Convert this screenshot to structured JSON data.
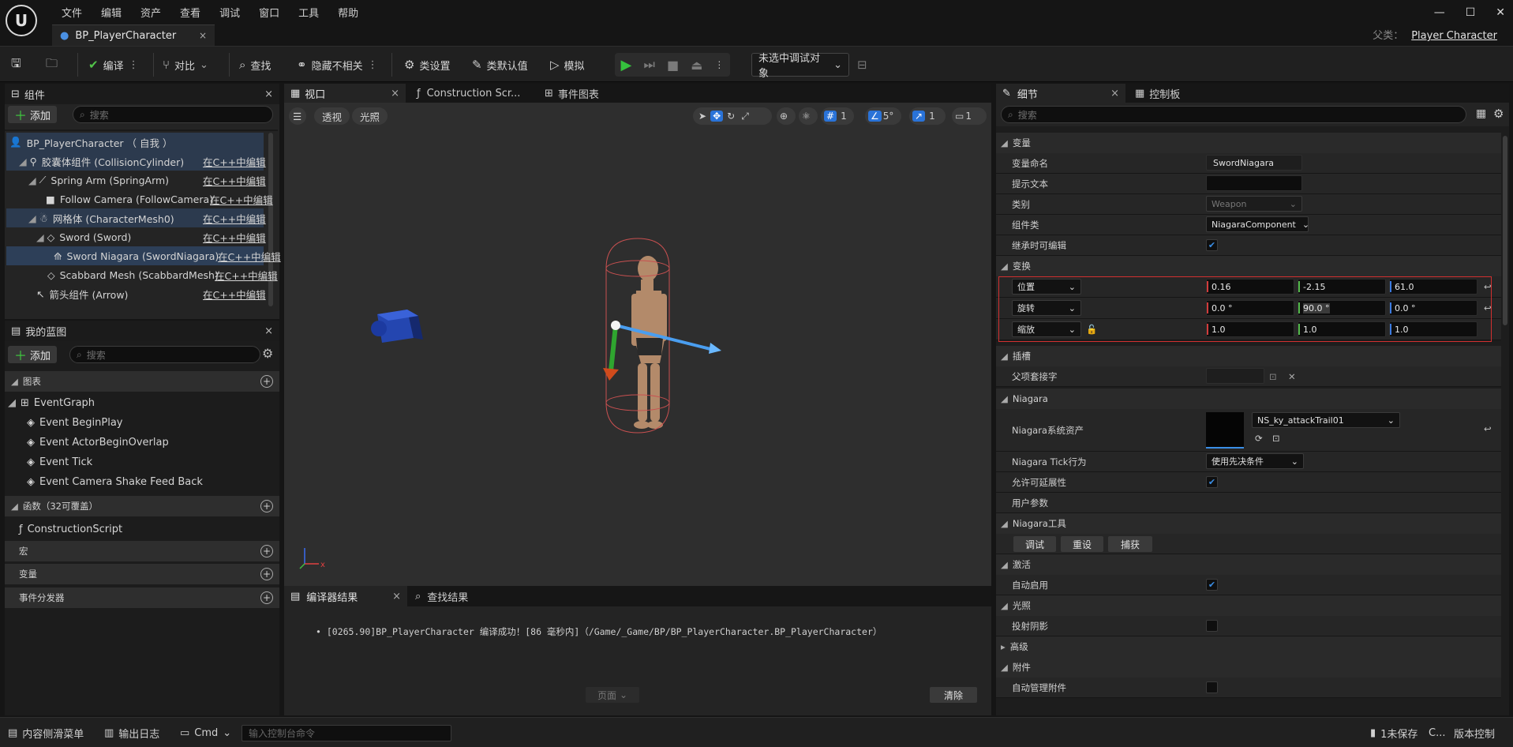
{
  "menu": [
    "文件",
    "编辑",
    "资产",
    "查看",
    "调试",
    "窗口",
    "工具",
    "帮助"
  ],
  "tab": {
    "title": "BP_PlayerCharacter",
    "close": "×"
  },
  "parent": {
    "label": "父类：",
    "value": "Player Character"
  },
  "window": {
    "min": "—",
    "max": "☐",
    "close": "✕"
  },
  "toolbar": {
    "compile": "编译",
    "diff": "对比",
    "find": "查找",
    "hide_unrelated": "隐藏不相关",
    "class_settings": "类设置",
    "class_defaults": "类默认值",
    "simulate": "模拟",
    "debug_target": "未选中调试对象"
  },
  "components": {
    "title": "组件",
    "close": "×",
    "add": "添加",
    "search_placeholder": "搜索",
    "items": [
      {
        "label": "BP_PlayerCharacter （ 自我 ）",
        "edit": ""
      },
      {
        "label": "胶囊体组件 (CollisionCylinder)",
        "edit": "在C++中编辑"
      },
      {
        "label": "Spring Arm (SpringArm)",
        "edit": "在C++中编辑"
      },
      {
        "label": "Follow Camera (FollowCamera)",
        "edit": "在C++中编辑"
      },
      {
        "label": "网格体 (CharacterMesh0)",
        "edit": "在C++中编辑"
      },
      {
        "label": "Sword (Sword)",
        "edit": "在C++中编辑"
      },
      {
        "label": "Sword Niagara (SwordNiagara)",
        "edit": "在C++中编辑"
      },
      {
        "label": "Scabbard Mesh (ScabbardMesh)",
        "edit": "在C++中编辑"
      },
      {
        "label": "箭头组件 (Arrow)",
        "edit": "在C++中编辑"
      }
    ]
  },
  "blueprint": {
    "title": "我的蓝图",
    "close": "×",
    "add": "添加",
    "search_placeholder": "搜索",
    "graphs": "图表",
    "event_graph": "EventGraph",
    "events": [
      "Event BeginPlay",
      "Event ActorBeginOverlap",
      "Event Tick",
      "Event Camera Shake Feed Back"
    ],
    "functions": "函数（32可覆盖）",
    "construction": "ConstructionScript",
    "macros": "宏",
    "variables": "变量",
    "dispatchers": "事件分发器"
  },
  "viewport_tabs": {
    "viewport": "视口",
    "construction": "Construction Scr...",
    "event_graph": "事件图表"
  },
  "viewport": {
    "perspective": "透视",
    "lit": "光照",
    "grid": "1",
    "angle": "5°",
    "scale": "1",
    "camera": "1"
  },
  "output_tabs": {
    "compiler": "编译器结果",
    "find": "查找结果"
  },
  "output": {
    "message": "[0265.90]BP_PlayerCharacter 编译成功！[86 毫秒内]（/Game/_Game/BP/BP_PlayerCharacter.BP_PlayerCharacter）",
    "page": "页面",
    "clear": "清除"
  },
  "details_tabs": {
    "details": "细节",
    "console": "控制板"
  },
  "details": {
    "search_placeholder": "搜索",
    "sec_variable": "变量",
    "var_name_label": "变量命名",
    "var_name": "SwordNiagara",
    "tooltip_label": "提示文本",
    "tooltip": "",
    "category_label": "类别",
    "category": "Weapon",
    "component_class_label": "组件类",
    "component_class": "NiagaraComponent",
    "editable_label": "继承时可编辑",
    "sec_transform": "变换",
    "location": "位置",
    "loc": [
      "0.16",
      "-2.15",
      "61.0"
    ],
    "rotation": "旋转",
    "rot": [
      "0.0 °",
      "90.0 °",
      "0.0 °"
    ],
    "scale": "缩放",
    "scl": [
      "1.0",
      "1.0",
      "1.0"
    ],
    "sec_socket": "插槽",
    "parent_socket": "父项套接字",
    "sec_niagara": "Niagara",
    "niagara_asset_label": "Niagara系统资产",
    "niagara_asset": "NS_ky_attackTrail01",
    "tick_label": "Niagara Tick行为",
    "tick": "使用先决条件",
    "scalability_label": "允许可延展性",
    "user_params": "用户参数",
    "sec_tools": "Niagara工具",
    "btn_debug": "调试",
    "btn_reset": "重设",
    "btn_capture": "捕获",
    "sec_activation": "激活",
    "auto_activate": "自动启用",
    "sec_lighting": "光照",
    "cast_shadow": "投射阴影",
    "sec_advanced": "高级",
    "sec_attachment": "附件",
    "auto_manage": "自动管理附件"
  },
  "statusbar": {
    "content_drawer": "内容侧滑菜单",
    "output_log": "输出日志",
    "cmd": "Cmd",
    "cmd_placeholder": "输入控制台命令",
    "unsaved": "1未保存",
    "source_control": "C...",
    "version_control": "版本控制"
  }
}
